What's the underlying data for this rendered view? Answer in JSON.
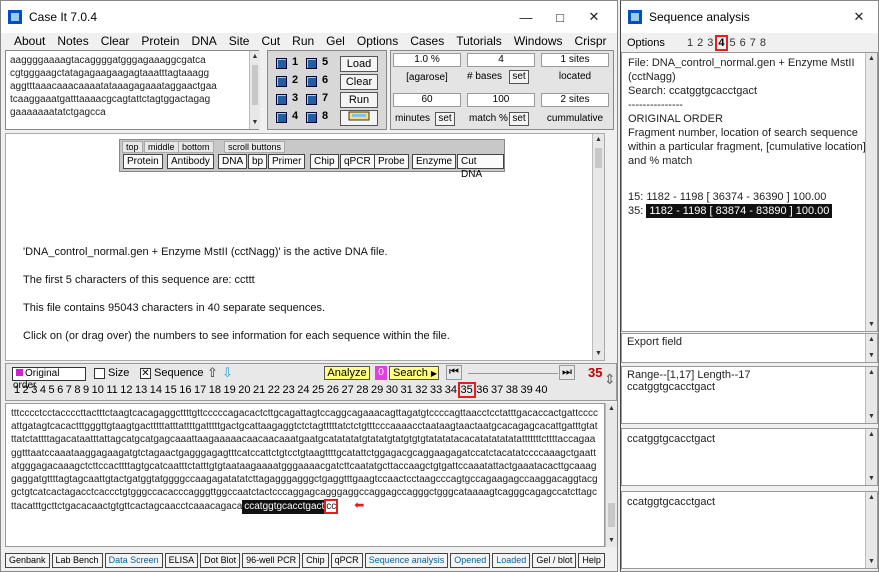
{
  "main_window": {
    "title": "Case It 7.0.4",
    "menu": [
      "About",
      "Notes",
      "Clear",
      "Protein",
      "DNA",
      "Site",
      "Cut",
      "Run",
      "Gel",
      "Options",
      "Cases",
      "Tutorials",
      "Windows",
      "Crispr"
    ],
    "seq_preview": "aaggggaaaagtacaggggatgggagaaaggcgatca\ncgtgggaagctatagagaagaagagtaaatttagtaaagg\naggtttaaacaaacaaaatataaagagaaataggaactgaa\ntcaaggaaatgatttaaaacgcagtattctagtggactagag\ngaaaaaaatatctgagcca",
    "grid": {
      "nums": [
        "1",
        "5",
        "2",
        "6",
        "3",
        "7",
        "4",
        "8"
      ],
      "load": "Load",
      "clear": "Clear",
      "run": "Run"
    },
    "agarose": {
      "value": "1.0 %",
      "label": "[agarose]"
    },
    "bases": {
      "value": "4",
      "label": "# bases",
      "set": "set"
    },
    "sites": {
      "value": "1 sites",
      "label": "located"
    },
    "minutes": {
      "value": "60",
      "label": "minutes",
      "set": "set"
    },
    "match": {
      "value": "100",
      "label": "match %",
      "set": "set"
    },
    "cumm": {
      "value": "2 sites",
      "label": "cummulative"
    },
    "toolbar_tabs": [
      "top",
      "middle",
      "bottom",
      "scroll buttons"
    ],
    "toolbar_buttons": [
      "Protein",
      "Antibody",
      "DNA",
      "bp",
      "Primer",
      "Chip",
      "qPCR",
      "Probe",
      "Enzyme",
      "Cut DNA"
    ],
    "info": {
      "active": "'DNA_control_normal.gen + Enzyme MstII (cctNagg)' is the active DNA file.",
      "first5": "The first 5 characters of this sequence are:  ccttt",
      "contains": "This file contains 95043 characters in 40 separate sequences.",
      "click": "Click on (or drag over) the numbers to see information for each sequence within the file."
    },
    "nav": {
      "original_order": "Original order",
      "size": "Size",
      "sequence": "Sequence",
      "analyze": "Analyze",
      "search_count": "0",
      "search": "Search",
      "current": "35",
      "numbers": [
        "1",
        "2",
        "3",
        "4",
        "5",
        "6",
        "7",
        "8",
        "9",
        "10",
        "11",
        "12",
        "13",
        "14",
        "15",
        "16",
        "17",
        "18",
        "19",
        "20",
        "21",
        "22",
        "23",
        "24",
        "25",
        "26",
        "27",
        "28",
        "29",
        "30",
        "31",
        "32",
        "33",
        "34",
        "35",
        "36",
        "37",
        "38",
        "39",
        "40"
      ]
    },
    "sequence_text": "tttcccctcctaccccttactttctaagtcacagaggcttttgttcccccagacactcttgcagattagtccaggcagaaacagttagatgtccccagttaacctcctatttgacaccactgattccccattgatagtcacactttgggttgtaagtgactttttatttattttgatttttgactgcattaagaggtctctagtttttatctctgtttcccaaaacctaataagtaactaatgcacagagcacattgatttgtatttatctattttagacataatttattagcatgcatgagcaaattaagaaaaacaacaacaaatgaatgcatatatatgtatatgtatgtgtgtatatatacacatatatatatatttttttcttttaccagaaggtttaatccaaataaggagaagatgtctagaactgagggagagtttcatccattctgtcctgtaagttttgcatattctggagacgcaggaagagatccatctacatatccccaaagctgaattatgggagacaaagctcttccacttttagtgcatcaatttctatttgtgtaataagaaaatgggaaaacgatcttcaatatgcttaccaagctgtgattccaaatattactgaaatacacttgcaaaggaggatgttttagtagcaattgtactgatggtatggggccaagagatatatcttagagggagggctgaggtttgaagtccaactcctaagcccagtgccagaagagccaaggacaggtacggctgtcatcactagacctcaccctgtgggccacacccagggttggccaatctactcccaggagcagggaggccaggagccagggctgggcataaaagtcagggcagagccatcttagcttacatttgcttctgacacaactgtgttcactagcaacctcaaacagaca",
    "highlight": "ccatggtgcacctgact",
    "tail": "cc",
    "bottom_buttons": [
      "Genbank",
      "Lab Bench",
      "Data Screen",
      "ELISA",
      "Dot Blot",
      "96-well PCR",
      "Chip",
      "qPCR",
      "Sequence analysis",
      "Opened",
      "Loaded",
      "Gel / blot",
      "Help"
    ]
  },
  "seq_window": {
    "title": "Sequence analysis",
    "options_label": "Options",
    "option_tabs": [
      "1",
      "2",
      "3",
      "4",
      "5",
      "6",
      "7",
      "8"
    ],
    "result": {
      "file": "File:  DNA_control_normal.gen + Enzyme MstII (cctNagg)",
      "search": "Search:  ccatggtgcacctgact",
      "dash": "---------------",
      "order": "ORIGINAL ORDER",
      "desc": "Fragment number, location of search sequence within a particular fragment, [cumulative location], and % match",
      "line1": "15: 1182 - 1198 [ 36374 - 36390 ]  100.00",
      "line2_num": "35:",
      "line2": "1182 - 1198 [ 83874 - 83890 ]  100.00"
    },
    "export_label": "Export field",
    "range": "Range--[1,17]  Length--17",
    "range_seq": "ccatggtgcacctgact",
    "seq2": "ccatggtgcacctgact",
    "seq3": "ccatggtgcacctgact"
  }
}
